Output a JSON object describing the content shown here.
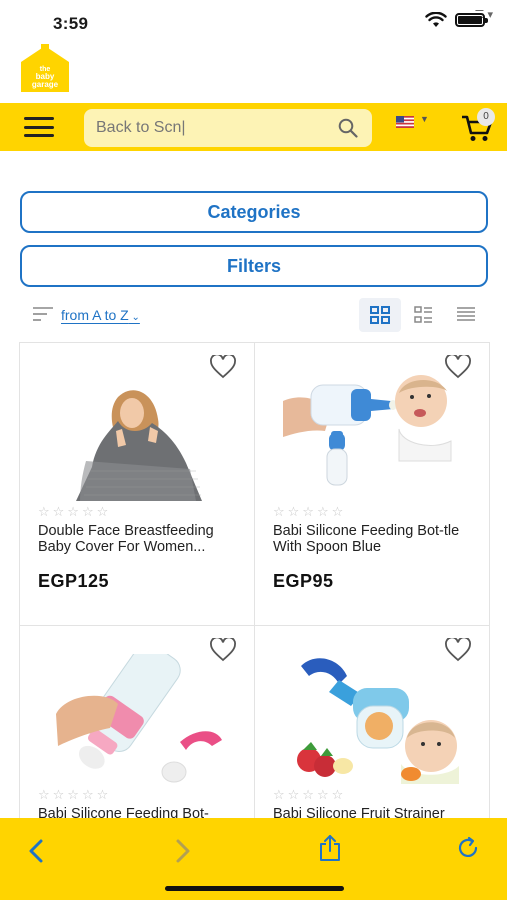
{
  "status_bar": {
    "time": "3:59"
  },
  "logo": {
    "text_line1": "the",
    "text_line2": "baby",
    "text_line3": "garage"
  },
  "header": {
    "search_value": "Back to Scn|",
    "search_placeholder": "Search",
    "cart_count": "0",
    "flag": "us-flag"
  },
  "buttons": {
    "categories": "Categories",
    "filters": "Filters"
  },
  "sort": {
    "label": "from A to Z"
  },
  "view_modes": [
    "grid-view-icon",
    "list-thumb-view-icon",
    "list-view-icon"
  ],
  "products": [
    {
      "name": "Double Face Breastfeeding Baby Cover For Women...",
      "price": "EGP125",
      "rating": 0
    },
    {
      "name": "Babi Silicone Feeding Bot-tle With Spoon Blue",
      "price": "EGP95",
      "rating": 0
    },
    {
      "name": "Babi Silicone Feeding Bot-",
      "price": "",
      "rating": 0
    },
    {
      "name": "Babi Silicone Fruit Strainer",
      "price": "",
      "rating": 0
    }
  ],
  "colors": {
    "brand_yellow": "#ffd400",
    "accent_blue": "#1f73c5"
  }
}
